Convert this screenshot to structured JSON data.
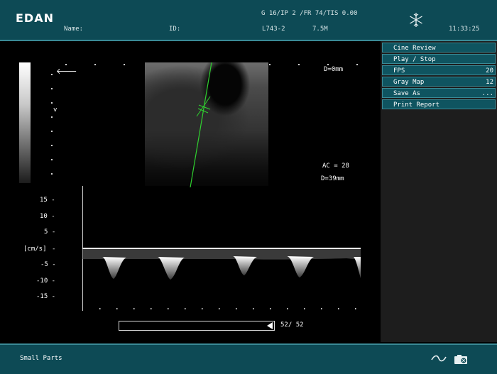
{
  "header": {
    "brand": "EDAN",
    "name_label": "Name:",
    "id_label": "ID:",
    "params": "G 16/IP 2 /FR 74/TIS 0.00",
    "probe": "L743-2",
    "frequency": "7.5M",
    "time": "11:33:25",
    "freeze_icon": "snowflake-icon"
  },
  "image": {
    "depth_top": "D=0mm",
    "ac": "AC = 28",
    "depth_bottom": "D=39mm",
    "focus_marker": "v",
    "doppler_axis": {
      "unit": "[cm/s]",
      "ticks": [
        "15 -",
        "10 -",
        "5 -",
        "-",
        "-5 -",
        "-10 -",
        "-15 -"
      ]
    },
    "cine": {
      "frame": "52/",
      "total": "52",
      "position_fraction": 1.0
    }
  },
  "menu": {
    "items": [
      {
        "label": "Cine Review",
        "value": ""
      },
      {
        "label": "Play / Stop",
        "value": ""
      },
      {
        "label": "FPS",
        "value": "20"
      },
      {
        "label": "Gray Map",
        "value": "12"
      },
      {
        "label": "Save As",
        "value": "..."
      },
      {
        "label": "Print Report",
        "value": ""
      }
    ]
  },
  "footer": {
    "preset": "Small Parts",
    "waveform_icon": "tilde-wave-icon",
    "camera_icon": "camera-icon"
  }
}
